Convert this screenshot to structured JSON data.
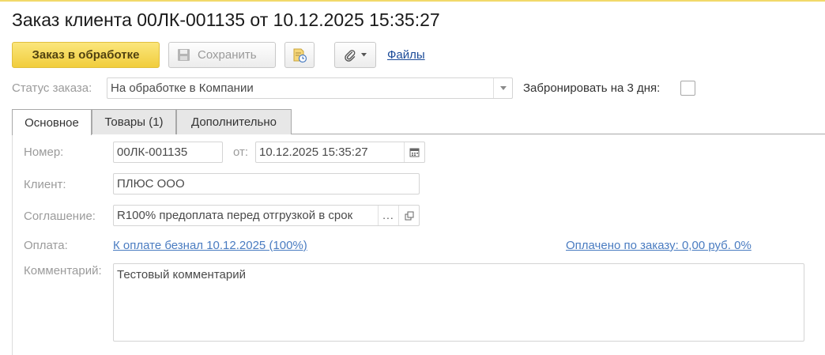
{
  "title": "Заказ клиента 00ЛК-001135 от 10.12.2025 15:35:27",
  "toolbar": {
    "primary_label": "Заказ в обработке",
    "save_label": "Сохранить",
    "report_icon": "report-icon",
    "attach_icon": "paperclip-icon",
    "files_link": "Файлы"
  },
  "status": {
    "label": "Статус заказа:",
    "value": "На обработке в Компании",
    "reserve_label": "Забронировать на 3 дня:",
    "reserve_checked": false
  },
  "tabs": [
    {
      "label": "Основное",
      "active": true
    },
    {
      "label": "Товары (1)",
      "active": false
    },
    {
      "label": "Дополнительно",
      "active": false
    }
  ],
  "form": {
    "number_label": "Номер:",
    "number_value": "00ЛК-001135",
    "date_label": "от:",
    "date_value": "10.12.2025 15:35:27",
    "client_label": "Клиент:",
    "client_value": "ПЛЮС ООО",
    "agreement_label": "Соглашение:",
    "agreement_value": "R100% предоплата перед отгрузкой в срок",
    "agreement_choose": "...",
    "payment_label": "Оплата:",
    "payment_link": "К оплате безнал 10.12.2025 (100%)",
    "paid_link": "Оплачено по заказу: 0,00 руб. 0%",
    "comment_label": "Комментарий:",
    "comment_value": "Тестовый комментарий"
  },
  "colors": {
    "primary_button": "#f1cd3c",
    "link": "#4a7cc1",
    "files_link": "#1a4a98"
  }
}
